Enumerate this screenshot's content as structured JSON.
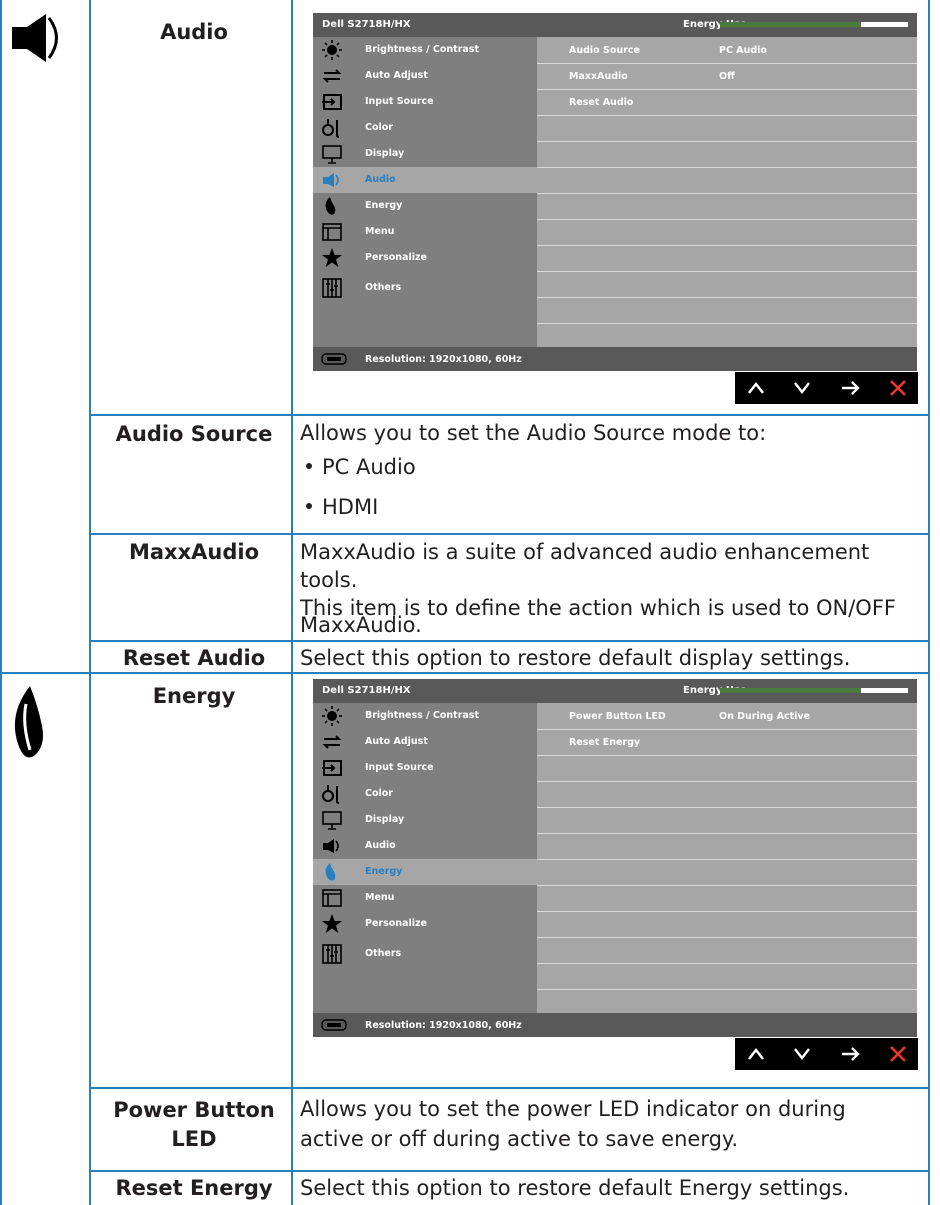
{
  "sections": {
    "audio": {
      "title": "Audio",
      "icon": "speaker-icon",
      "osd": {
        "model": "Dell S2718H/HX",
        "energy_label": "Energy Use",
        "energy_level": 0.75,
        "menu": [
          "Brightness / Contrast",
          "Auto Adjust",
          "Input Source",
          "Color",
          "Display",
          "Audio",
          "Energy",
          "Menu",
          "Personalize",
          "Others"
        ],
        "active_item": "Audio",
        "rows": [
          {
            "key": "Audio Source",
            "value": "PC Audio"
          },
          {
            "key": "MaxxAudio",
            "value": "Off"
          },
          {
            "key": "Reset Audio",
            "value": ""
          }
        ],
        "resolution": "Resolution: 1920x1080, 60Hz"
      },
      "items": [
        {
          "label": "Audio Source",
          "desc": "Allows you to set the Audio Source mode to:",
          "bullets": [
            "PC Audio",
            "HDMI"
          ]
        },
        {
          "label": "MaxxAudio",
          "desc1": "MaxxAudio is a suite of advanced audio enhancement",
          "desc2": "tools.",
          "desc3": "This item is to define the action which is used to ON/OFF",
          "desc4": "MaxxAudio."
        },
        {
          "label": "Reset Audio",
          "desc": "Select this option to restore default display settings."
        }
      ]
    },
    "energy": {
      "title": "Energy",
      "icon": "leaf-icon",
      "osd": {
        "model": "Dell S2718H/HX",
        "energy_label": "Energy Use",
        "energy_level": 0.75,
        "menu": [
          "Brightness / Contrast",
          "Auto Adjust",
          "Input Source",
          "Color",
          "Display",
          "Audio",
          "Energy",
          "Menu",
          "Personalize",
          "Others"
        ],
        "active_item": "Energy",
        "rows": [
          {
            "key": "Power Button LED",
            "value": "On During Active"
          },
          {
            "key": "Reset Energy",
            "value": ""
          }
        ],
        "resolution": "Resolution: 1920x1080, 60Hz"
      },
      "items": [
        {
          "label1": "Power Button",
          "label2": "LED",
          "desc1": "Allows you to set the power LED indicator on during",
          "desc2": "active or off during active to save energy."
        },
        {
          "label": "Reset Energy",
          "desc": "Select this option to restore default Energy settings."
        }
      ]
    }
  },
  "nav_buttons": [
    "up-arrow-icon",
    "down-arrow-icon",
    "right-arrow-icon",
    "close-icon"
  ],
  "colors": {
    "rule": "#2a7fc1",
    "osd_dark": "#595959",
    "osd_menu": "#7f7f7f",
    "osd_panel": "#a6a6a6",
    "highlight": "#2a7fc1",
    "close": "#e8382f"
  }
}
